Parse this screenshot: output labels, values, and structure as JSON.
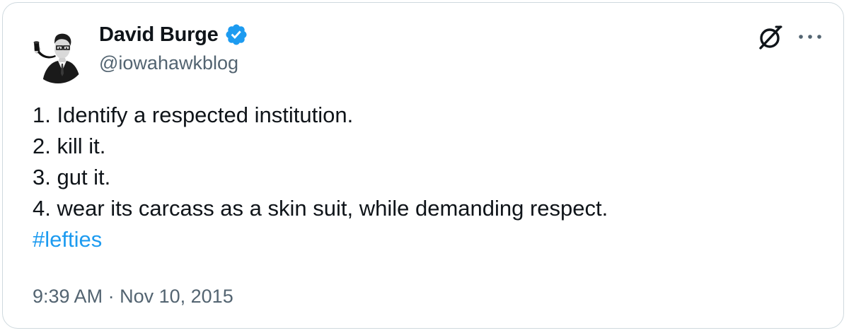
{
  "author": {
    "display_name": "David Burge",
    "handle": "@iowahawkblog",
    "verified": true,
    "verified_color": "#1d9bf0"
  },
  "header_icons": {
    "left": "grok-icon",
    "right": "more-options-icon"
  },
  "tweet": {
    "lines": [
      "1. Identify a respected institution.",
      "2. kill it.",
      "3. gut it.",
      "4. wear its carcass as a skin suit, while demanding respect."
    ],
    "hashtag": "#lefties",
    "hashtag_color": "#1d9bf0"
  },
  "meta": {
    "time": "9:39 AM",
    "separator": "·",
    "date": "Nov 10, 2015"
  }
}
